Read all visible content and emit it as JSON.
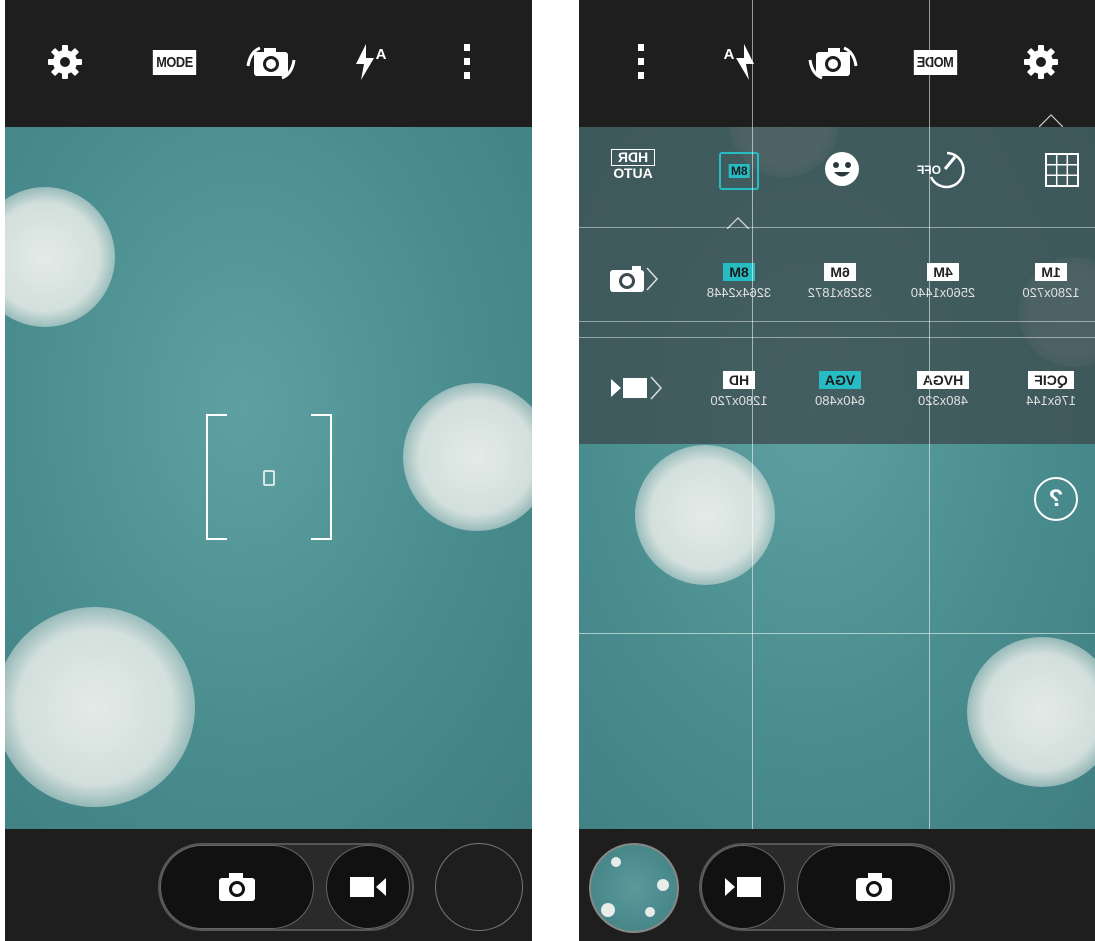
{
  "left": {
    "topbar": {
      "icons": [
        "gear-icon",
        "mode-icon",
        "switch-camera-icon",
        "flash-auto-icon",
        "more-vert-icon"
      ],
      "mode_label": "MODE",
      "flash_label": "A"
    },
    "bottombar": {
      "icons": [
        "camera-icon",
        "video-camera-icon"
      ]
    }
  },
  "right": {
    "topbar": {
      "icons": [
        "more-vert-icon",
        "flash-auto-icon",
        "switch-camera-icon",
        "mode-icon",
        "gear-icon"
      ],
      "mode_label": "MODE",
      "flash_label": "A"
    },
    "settings": {
      "icons_row": [
        {
          "name": "hdr-auto-icon",
          "top": "HDR",
          "bottom": "AUTO"
        },
        {
          "name": "resolution-8m-icon",
          "label": "8M",
          "selected": true
        },
        {
          "name": "face-icon"
        },
        {
          "name": "timer-off-icon",
          "label": "OFF"
        },
        {
          "name": "grid-icon"
        }
      ],
      "photo_resolutions": [
        {
          "badge": "8M",
          "dims": "3264x2448",
          "selected": true
        },
        {
          "badge": "6M",
          "dims": "3328x1872",
          "selected": false
        },
        {
          "badge": "4M",
          "dims": "2560x1440",
          "selected": false
        },
        {
          "badge": "1M",
          "dims": "1280x720",
          "selected": false
        }
      ],
      "video_resolutions": [
        {
          "badge": "HD",
          "dims": "1280x720",
          "selected": false
        },
        {
          "badge": "VGA",
          "dims": "640x480",
          "selected": true
        },
        {
          "badge": "HVGA",
          "dims": "480x320",
          "selected": false
        },
        {
          "badge": "QCIF",
          "dims": "176x144",
          "selected": false
        }
      ]
    },
    "help_label": "?"
  },
  "colors": {
    "accent": "#27bcc3",
    "bar": "#1e1e1e",
    "viewfinder": "#4f9294"
  }
}
